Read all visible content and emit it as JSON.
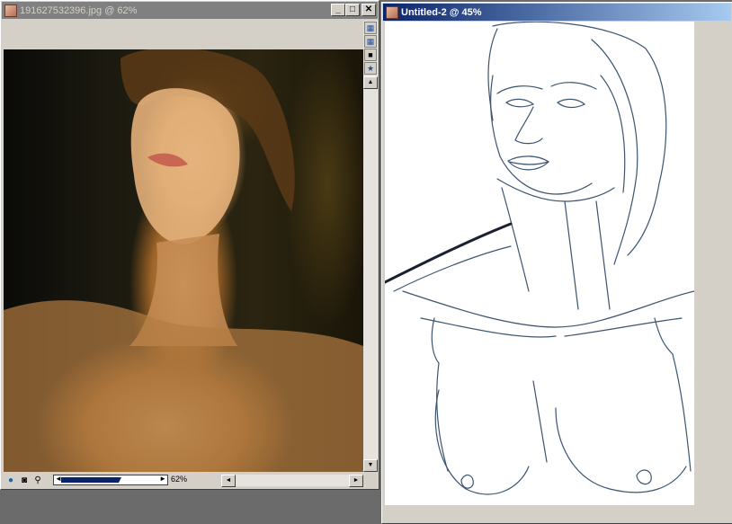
{
  "windows": {
    "reference": {
      "title": "191627532396.jpg @ 62%",
      "zoom_label": "62%",
      "zoom_level": 0.62
    },
    "sketch": {
      "title": "Untitled-2 @ 45%"
    }
  },
  "title_buttons": {
    "minimize": "_",
    "maximize": "□",
    "close": "✕"
  },
  "icons": {
    "app_icon": "portrait-thumbnail-icon",
    "globe": "globe-icon",
    "binoculars": "binoculars-icon",
    "magnifier": "magnifier-icon",
    "scroll_left": "◄",
    "scroll_right": "►",
    "scroll_up": "▲",
    "scroll_down": "▼"
  },
  "colors": {
    "active_title": "#0a246a",
    "inactive_title": "#808080",
    "workspace": "#6b6b6b",
    "sketch_stroke": "#3c5470"
  }
}
